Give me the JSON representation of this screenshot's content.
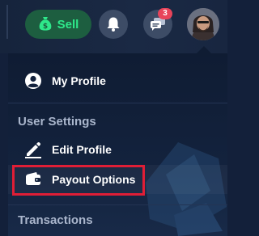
{
  "header": {
    "sell_label": "Sell",
    "notifications_icon": "bell-icon",
    "messages_icon": "chat-icon",
    "messages_badge": "3",
    "avatar_icon": "user-avatar"
  },
  "menu": {
    "my_profile": "My Profile",
    "user_settings_header": "User Settings",
    "edit_profile": "Edit Profile",
    "payout_options": "Payout Options",
    "transactions_header": "Transactions"
  },
  "colors": {
    "sell_bg": "#1d5e40",
    "sell_text": "#2ee88a",
    "badge": "#e8445a",
    "highlight": "#e01e36"
  }
}
